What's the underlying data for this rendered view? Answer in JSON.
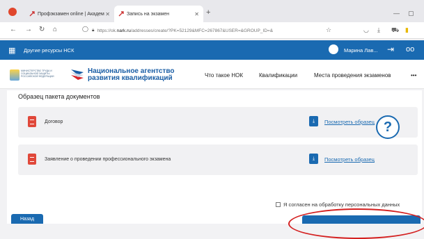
{
  "browser": {
    "tabs": [
      {
        "label": "Профэкзамен online | Академ"
      },
      {
        "label": "Запись на экзамен"
      }
    ],
    "url_prefix": "https://ok.",
    "url_domain": "nark.ru",
    "url_rest": "/addresses/create/?PK=52129&MFC=267867&USER=&GROUP_ID=&"
  },
  "sitebar": {
    "other_resources": "Другие ресурсы НСК",
    "user_name": "Марина Лав..."
  },
  "header": {
    "mintrud_text": "МИНИСТЕРСТВО ТРУДА И СОЦИАЛЬНОЙ ЗАЩИТЫ РОССИЙСКОЙ ФЕДЕРАЦИИ",
    "nak_line1": "Национальное агентство",
    "nak_line2": "развития квалификаций",
    "nav": [
      "Что такое НОК",
      "Квалификации",
      "Места проведения экзаменов",
      "•••"
    ]
  },
  "main": {
    "section_title": "Образец пакета документов",
    "documents": [
      {
        "name": "Договор",
        "link": "Посмотреть образец"
      },
      {
        "name": "Заявление о проведении профессионального экзамена",
        "link": "Посмотреть образец"
      }
    ],
    "help_label": "?",
    "consent_label": "Я согласен на обработку персональных данных",
    "back_label": "Назад"
  },
  "colors": {
    "brand": "#1a6ab1",
    "doc_icon": "#e0483a",
    "annotation": "#d42020"
  }
}
